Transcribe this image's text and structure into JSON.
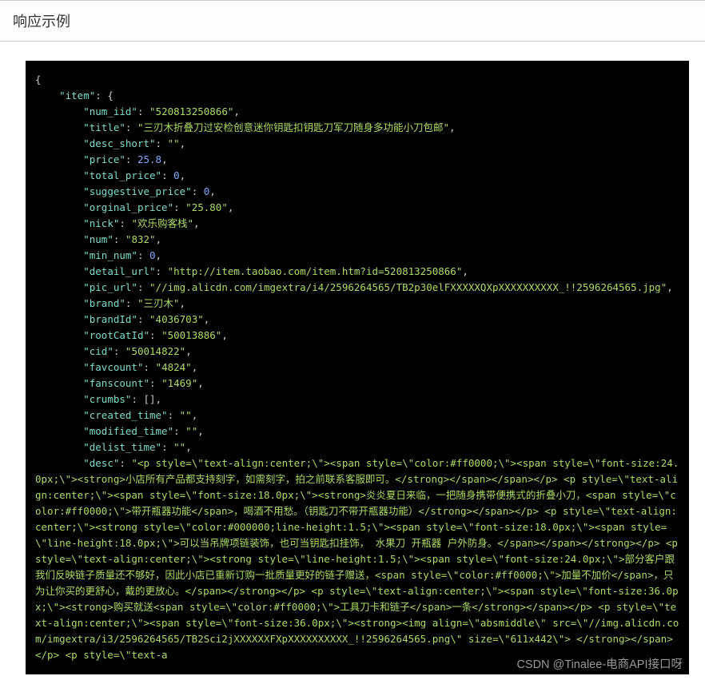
{
  "header": {
    "title": "响应示例"
  },
  "watermark": "CSDN @Tinalee-电商API接口呀",
  "json": {
    "item_key": "\"item\"",
    "fields": [
      {
        "k": "\"num_iid\"",
        "v": "\"520813250866\""
      },
      {
        "k": "\"title\"",
        "v": "\"三刃木折叠刀过安检创意迷你钥匙扣钥匙刀军刀随身多功能小刀包邮\""
      },
      {
        "k": "\"desc_short\"",
        "v": "\"\""
      },
      {
        "k": "\"price\"",
        "v": "25.8"
      },
      {
        "k": "\"total_price\"",
        "v": "0"
      },
      {
        "k": "\"suggestive_price\"",
        "v": "0"
      },
      {
        "k": "\"orginal_price\"",
        "v": "\"25.80\""
      },
      {
        "k": "\"nick\"",
        "v": "\"欢乐购客栈\""
      },
      {
        "k": "\"num\"",
        "v": "\"832\""
      },
      {
        "k": "\"min_num\"",
        "v": "0"
      },
      {
        "k": "\"detail_url\"",
        "v": "\"http://item.taobao.com/item.htm?id=520813250866\""
      },
      {
        "k": "\"pic_url\"",
        "v": "\"//img.alicdn.com/imgextra/i4/2596264565/TB2p30elFXXXXXQXpXXXXXXXXXX_!!2596264565.jpg\""
      },
      {
        "k": "\"brand\"",
        "v": "\"三刃木\""
      },
      {
        "k": "\"brandId\"",
        "v": "\"4036703\""
      },
      {
        "k": "\"rootCatId\"",
        "v": "\"50013886\""
      },
      {
        "k": "\"cid\"",
        "v": "\"50014822\""
      },
      {
        "k": "\"favcount\"",
        "v": "\"4824\""
      },
      {
        "k": "\"fanscount\"",
        "v": "\"1469\""
      },
      {
        "k": "\"crumbs\"",
        "v": "[]"
      },
      {
        "k": "\"created_time\"",
        "v": "\"\""
      },
      {
        "k": "\"modified_time\"",
        "v": "\"\""
      },
      {
        "k": "\"delist_time\"",
        "v": "\"\""
      },
      {
        "k": "\"desc\"",
        "v": ""
      }
    ],
    "desc": "\"<p style=\\\"text-align:center;\\\"><span style=\\\"color:#ff0000;\\\"><span style=\\\"font-size:24.0px;\\\"><strong>小店所有产品都支持刻字，如需刻字，拍之前联系客服即可。</strong></span></span></p> <p style=\\\"text-align:center;\\\"><span style=\\\"font-size:18.0px;\\\"><strong>炎炎夏日来临，一把随身携带便携式的折叠小刀，<span style=\\\"color:#ff0000;\\\">带开瓶器功能</span>，喝酒不用愁。（钥匙刀不带开瓶器功能）</strong></span></p> <p style=\\\"text-align:center;\\\"><strong style=\\\"color:#000000;line-height:1.5;\\\"><span style=\\\"font-size:18.0px;\\\"><span style=\\\"line-height:18.0px;\\\">可以当吊牌项链装饰，也可当钥匙扣挂饰， 水果刀 开瓶器 户外防身。</span></span></strong></p> <p style=\\\"text-align:center;\\\"><strong style=\\\"line-height:1.5;\\\"><span style=\\\"font-size:24.0px;\\\">部分客户跟我们反映链子质量还不够好，因此小店已重新订购一批质量更好的链子赠送，<span style=\\\"color:#ff0000;\\\">加量不加价</span>，只为让你买的更舒心，戴的更放心。</span></strong></p> <p style=\\\"text-align:center;\\\"><span style=\\\"font-size:36.0px;\\\"><strong>购买就送<span style=\\\"color:#ff0000;\\\">工具刀卡和链子</span>一条</strong></span></p> <p style=\\\"text-align:center;\\\"><span style=\\\"font-size:36.0px;\\\"><strong><img align=\\\"absmiddle\\\" src=\\\"//img.alicdn.com/imgextra/i3/2596264565/TB2Sci2jXXXXXXFXpXXXXXXXXXX_!!2596264565.png\\\" size=\\\"611x442\\\"> </strong></span></p> <p style=\\\"text-a"
  }
}
